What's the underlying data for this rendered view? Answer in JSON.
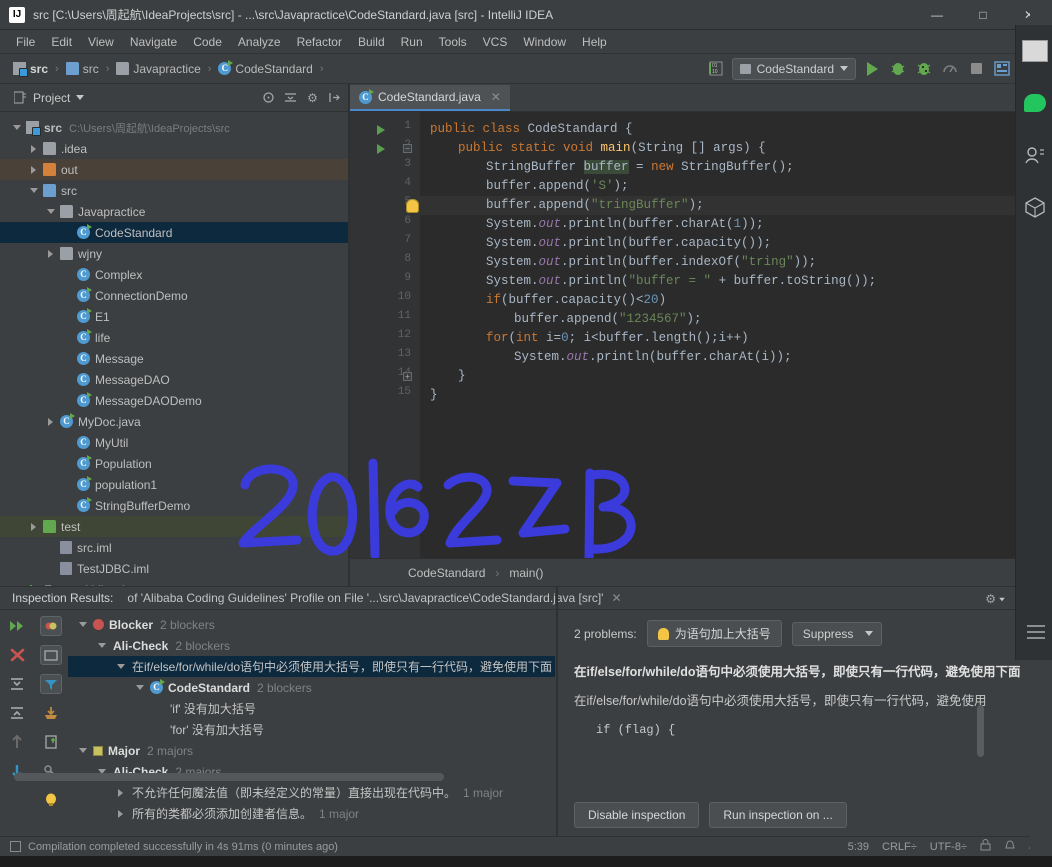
{
  "window": {
    "title": "src [C:\\Users\\周起航\\IdeaProjects\\src] - ...\\src\\Javapractice\\CodeStandard.java [src] - IntelliJ IDEA",
    "logo_text": "IJ",
    "minimize": "—",
    "maximize": "□",
    "close": "✕"
  },
  "menubar": {
    "items": [
      "File",
      "Edit",
      "View",
      "Navigate",
      "Code",
      "Analyze",
      "Refactor",
      "Build",
      "Run",
      "Tools",
      "VCS",
      "Window",
      "Help"
    ]
  },
  "toolbar": {
    "breadcrumbs": [
      {
        "label": "src",
        "icon": "source-root-folder-icon",
        "bold": true
      },
      {
        "label": "src",
        "icon": "folder-blue-icon",
        "bold": false
      },
      {
        "label": "Javapractice",
        "icon": "package-folder-icon",
        "bold": false
      },
      {
        "label": "CodeStandard",
        "icon": "java-class-icon",
        "bold": false
      }
    ],
    "separator": "›",
    "run_config": "CodeStandard",
    "icons": [
      "binary-toggle-icon",
      "run-icon",
      "debug-icon",
      "run-coverage-icon",
      "profile-icon",
      "stop-icon",
      "layout-icon"
    ]
  },
  "project_panel": {
    "title": "Project",
    "header_icons": [
      "locate-icon",
      "collapse-all-icon",
      "settings-gear-icon",
      "hide-icon"
    ],
    "tree": [
      {
        "depth": 0,
        "arrow": "down",
        "icon": "source-root-folder-icon",
        "label": "src",
        "path": "C:\\Users\\周起航\\IdeaProjects\\src",
        "bold": true,
        "state": "normal"
      },
      {
        "depth": 1,
        "arrow": "right",
        "icon": "folder-grey-icon",
        "label": ".idea",
        "path": "",
        "bold": false,
        "state": "normal"
      },
      {
        "depth": 1,
        "arrow": "right",
        "icon": "folder-orange-icon",
        "label": "out",
        "path": "",
        "bold": false,
        "state": "out"
      },
      {
        "depth": 1,
        "arrow": "down",
        "icon": "folder-blue-icon",
        "label": "src",
        "path": "",
        "bold": false,
        "state": "normal"
      },
      {
        "depth": 2,
        "arrow": "down",
        "icon": "package-folder-icon",
        "label": "Javapractice",
        "path": "",
        "bold": false,
        "state": "normal"
      },
      {
        "depth": 3,
        "arrow": "none",
        "icon": "java-class-runnable-icon",
        "label": "CodeStandard",
        "path": "",
        "bold": false,
        "state": "selected"
      },
      {
        "depth": 2,
        "arrow": "right",
        "icon": "package-folder-icon",
        "label": "wjny",
        "path": "",
        "bold": false,
        "state": "normal"
      },
      {
        "depth": 3,
        "arrow": "none",
        "icon": "java-class-icon",
        "label": "Complex",
        "path": "",
        "bold": false,
        "state": "normal"
      },
      {
        "depth": 3,
        "arrow": "none",
        "icon": "java-class-runnable-icon",
        "label": "ConnectionDemo",
        "path": "",
        "bold": false,
        "state": "normal"
      },
      {
        "depth": 3,
        "arrow": "none",
        "icon": "java-class-runnable-icon",
        "label": "E1",
        "path": "",
        "bold": false,
        "state": "normal"
      },
      {
        "depth": 3,
        "arrow": "none",
        "icon": "java-class-runnable-icon",
        "label": "life",
        "path": "",
        "bold": false,
        "state": "normal"
      },
      {
        "depth": 3,
        "arrow": "none",
        "icon": "java-class-icon",
        "label": "Message",
        "path": "",
        "bold": false,
        "state": "normal"
      },
      {
        "depth": 3,
        "arrow": "none",
        "icon": "java-class-icon",
        "label": "MessageDAO",
        "path": "",
        "bold": false,
        "state": "normal"
      },
      {
        "depth": 3,
        "arrow": "none",
        "icon": "java-class-runnable-icon",
        "label": "MessageDAODemo",
        "path": "",
        "bold": false,
        "state": "normal"
      },
      {
        "depth": 2,
        "arrow": "right",
        "icon": "java-class-runnable-icon",
        "label": "MyDoc.java",
        "path": "",
        "bold": false,
        "state": "normal"
      },
      {
        "depth": 3,
        "arrow": "none",
        "icon": "java-class-icon",
        "label": "MyUtil",
        "path": "",
        "bold": false,
        "state": "normal"
      },
      {
        "depth": 3,
        "arrow": "none",
        "icon": "java-class-runnable-icon",
        "label": "Population",
        "path": "",
        "bold": false,
        "state": "normal"
      },
      {
        "depth": 3,
        "arrow": "none",
        "icon": "java-class-runnable-icon",
        "label": "population1",
        "path": "",
        "bold": false,
        "state": "normal"
      },
      {
        "depth": 3,
        "arrow": "none",
        "icon": "java-class-runnable-icon",
        "label": "StringBufferDemo",
        "path": "",
        "bold": false,
        "state": "normal"
      },
      {
        "depth": 1,
        "arrow": "right",
        "icon": "folder-green-icon",
        "label": "test",
        "path": "",
        "bold": false,
        "state": "test"
      },
      {
        "depth": 2,
        "arrow": "none",
        "icon": "iml-file-icon",
        "label": "src.iml",
        "path": "",
        "bold": false,
        "state": "normal"
      },
      {
        "depth": 2,
        "arrow": "none",
        "icon": "iml-file-icon",
        "label": "TestJDBC.iml",
        "path": "",
        "bold": false,
        "state": "normal"
      },
      {
        "depth": 0,
        "arrow": "down",
        "icon": "external-libraries-icon",
        "label": "External Libraries",
        "path": "",
        "bold": false,
        "state": "normal"
      }
    ]
  },
  "editor": {
    "tab": {
      "label": "CodeStandard.java",
      "icon": "java-class-runnable-icon",
      "close": "✕"
    },
    "lines": [
      {
        "no": "1",
        "indent": 0,
        "tokens": [
          {
            "t": "public ",
            "c": "kw"
          },
          {
            "t": "class ",
            "c": "kw"
          },
          {
            "t": "CodeStandard",
            "c": "cls"
          },
          {
            "t": " {",
            "c": "ident"
          }
        ]
      },
      {
        "no": "2",
        "indent": 1,
        "tokens": [
          {
            "t": "public ",
            "c": "kw"
          },
          {
            "t": "static ",
            "c": "kw"
          },
          {
            "t": "void ",
            "c": "kw"
          },
          {
            "t": "main",
            "c": "mth"
          },
          {
            "t": "(String [] args) {",
            "c": "ident"
          }
        ]
      },
      {
        "no": "3",
        "indent": 2,
        "tokens": [
          {
            "t": "StringBuffer ",
            "c": "ident"
          },
          {
            "t": "buffer",
            "c": "hl-word"
          },
          {
            "t": " = ",
            "c": "ident"
          },
          {
            "t": "new ",
            "c": "kw"
          },
          {
            "t": "StringBuffer();",
            "c": "ident"
          }
        ]
      },
      {
        "no": "4",
        "indent": 2,
        "tokens": [
          {
            "t": "buffer.append(",
            "c": "ident"
          },
          {
            "t": "'S'",
            "c": "str"
          },
          {
            "t": ");",
            "c": "ident"
          }
        ]
      },
      {
        "no": "5",
        "indent": 2,
        "tokens": [
          {
            "t": "buffer.append(",
            "c": "ident"
          },
          {
            "t": "\"tringBuffer\"",
            "c": "str"
          },
          {
            "t": ");",
            "c": "ident"
          }
        ]
      },
      {
        "no": "6",
        "indent": 2,
        "tokens": [
          {
            "t": "System.",
            "c": "ident"
          },
          {
            "t": "out",
            "c": "fld"
          },
          {
            "t": ".println(buffer.charAt(",
            "c": "ident"
          },
          {
            "t": "1",
            "c": "num"
          },
          {
            "t": "));",
            "c": "ident"
          }
        ]
      },
      {
        "no": "7",
        "indent": 2,
        "tokens": [
          {
            "t": "System.",
            "c": "ident"
          },
          {
            "t": "out",
            "c": "fld"
          },
          {
            "t": ".println(buffer.capacity());",
            "c": "ident"
          }
        ]
      },
      {
        "no": "8",
        "indent": 2,
        "tokens": [
          {
            "t": "System.",
            "c": "ident"
          },
          {
            "t": "out",
            "c": "fld"
          },
          {
            "t": ".println(buffer.indexOf(",
            "c": "ident"
          },
          {
            "t": "\"tring\"",
            "c": "str"
          },
          {
            "t": "));",
            "c": "ident"
          }
        ]
      },
      {
        "no": "9",
        "indent": 2,
        "tokens": [
          {
            "t": "System.",
            "c": "ident"
          },
          {
            "t": "out",
            "c": "fld"
          },
          {
            "t": ".println(",
            "c": "ident"
          },
          {
            "t": "\"buffer = \"",
            "c": "str"
          },
          {
            "t": " + buffer.toString());",
            "c": "ident"
          }
        ]
      },
      {
        "no": "10",
        "indent": 2,
        "tokens": [
          {
            "t": "if",
            "c": "kw"
          },
          {
            "t": "(buffer.capacity()<",
            "c": "ident"
          },
          {
            "t": "20",
            "c": "num"
          },
          {
            "t": ")",
            "c": "ident"
          }
        ]
      },
      {
        "no": "11",
        "indent": 3,
        "tokens": [
          {
            "t": "buffer.append(",
            "c": "ident"
          },
          {
            "t": "\"1234567\"",
            "c": "str"
          },
          {
            "t": ");",
            "c": "ident"
          }
        ]
      },
      {
        "no": "12",
        "indent": 2,
        "tokens": [
          {
            "t": "for",
            "c": "kw"
          },
          {
            "t": "(",
            "c": "ident"
          },
          {
            "t": "int",
            "c": "kw"
          },
          {
            "t": " i=",
            "c": "ident"
          },
          {
            "t": "0",
            "c": "num"
          },
          {
            "t": "; i<buffer.length();i++)",
            "c": "ident"
          }
        ]
      },
      {
        "no": "13",
        "indent": 3,
        "tokens": [
          {
            "t": "System.",
            "c": "ident"
          },
          {
            "t": "out",
            "c": "fld"
          },
          {
            "t": ".println(buffer.charAt(i));",
            "c": "ident"
          }
        ]
      },
      {
        "no": "14",
        "indent": 1,
        "tokens": [
          {
            "t": "}",
            "c": "ident"
          }
        ]
      },
      {
        "no": "15",
        "indent": 0,
        "tokens": [
          {
            "t": "}",
            "c": "ident"
          }
        ]
      }
    ],
    "breadcrumb": [
      "CodeStandard",
      "main()"
    ],
    "breadcrumb_sep": "›"
  },
  "annotation": {
    "text": "20161213",
    "color": "#3b3bdb"
  },
  "inspection": {
    "header_label": "Inspection Results:",
    "header_detail": "of 'Alibaba Coding Guidelines' Profile on File '...\\src\\Javapractice\\CodeStandard.java [src]'",
    "close": "✕",
    "gear": "⚙",
    "toolbar_icons": [
      "next-problem-icon",
      "group-by-severity-icon",
      "close-inspection-icon",
      "open-file-icon",
      "expand-all-icon",
      "filter-icon",
      "collapse-all-icon",
      "export-icon",
      "previous-occurrence-icon",
      "edit-settings-icon",
      "next-occurrence-icon",
      "quick-fix-bulb-icon"
    ],
    "tree": [
      {
        "depth": 0,
        "arrow": "down",
        "icon": "blocker-severity-icon",
        "label": "Blocker",
        "count": "2 blockers",
        "bold": true,
        "selected": false
      },
      {
        "depth": 1,
        "arrow": "down",
        "icon": "none",
        "label": "Ali-Check",
        "count": "2 blockers",
        "bold": true,
        "selected": false
      },
      {
        "depth": 2,
        "arrow": "down",
        "icon": "none",
        "label": "在if/else/for/while/do语句中必须使用大括号，即使只有一行代码，避免使用下面",
        "count": "",
        "bold": false,
        "selected": true
      },
      {
        "depth": 3,
        "arrow": "down",
        "icon": "java-class-runnable-icon",
        "label": "CodeStandard",
        "count": "2 blockers",
        "bold": true,
        "selected": false
      },
      {
        "depth": 4,
        "arrow": "none",
        "icon": "none",
        "label": "'if' 没有加大括号",
        "count": "",
        "bold": false,
        "selected": false
      },
      {
        "depth": 4,
        "arrow": "none",
        "icon": "none",
        "label": "'for' 没有加大括号",
        "count": "",
        "bold": false,
        "selected": false
      },
      {
        "depth": 0,
        "arrow": "down",
        "icon": "major-severity-icon",
        "label": "Major",
        "count": "2 majors",
        "bold": true,
        "selected": false
      },
      {
        "depth": 1,
        "arrow": "down",
        "icon": "none",
        "label": "Ali-Check",
        "count": "2 majors",
        "bold": true,
        "selected": false
      },
      {
        "depth": 2,
        "arrow": "right",
        "icon": "none",
        "label": "不允许任何魔法值（即未经定义的常量）直接出现在代码中。",
        "count": "1 major",
        "bold": false,
        "selected": false
      },
      {
        "depth": 2,
        "arrow": "right",
        "icon": "none",
        "label": "所有的类都必须添加创建者信息。",
        "count": "1 major",
        "bold": false,
        "selected": false
      }
    ],
    "detail": {
      "problem_count": "2 problems:",
      "fix_label": "为语句加上大括号",
      "suppress_label": "Suppress",
      "title": "在if/else/for/while/do语句中必须使用大括号，即使只有一行代码，避免使用下面的",
      "body": "在if/else/for/while/do语句中必须使用大括号，即使只有一行代码，避免使用",
      "code_sample": "if (flag) {",
      "buttons": [
        "Disable inspection",
        "Run inspection on ..."
      ]
    }
  },
  "statusbar": {
    "message": "Compilation completed successfully in 4s 91ms (0 minutes ago)",
    "caret": "5:39",
    "line_sep": "CRLF÷",
    "encoding": "UTF-8÷",
    "icons": [
      "lock-icon",
      "event-log-icon",
      "memory-icon"
    ]
  },
  "right_overlay": {
    "icons": [
      "image-thumbnail-icon",
      "chat-bubble-icon",
      "contacts-icon",
      "cube-icon"
    ]
  }
}
